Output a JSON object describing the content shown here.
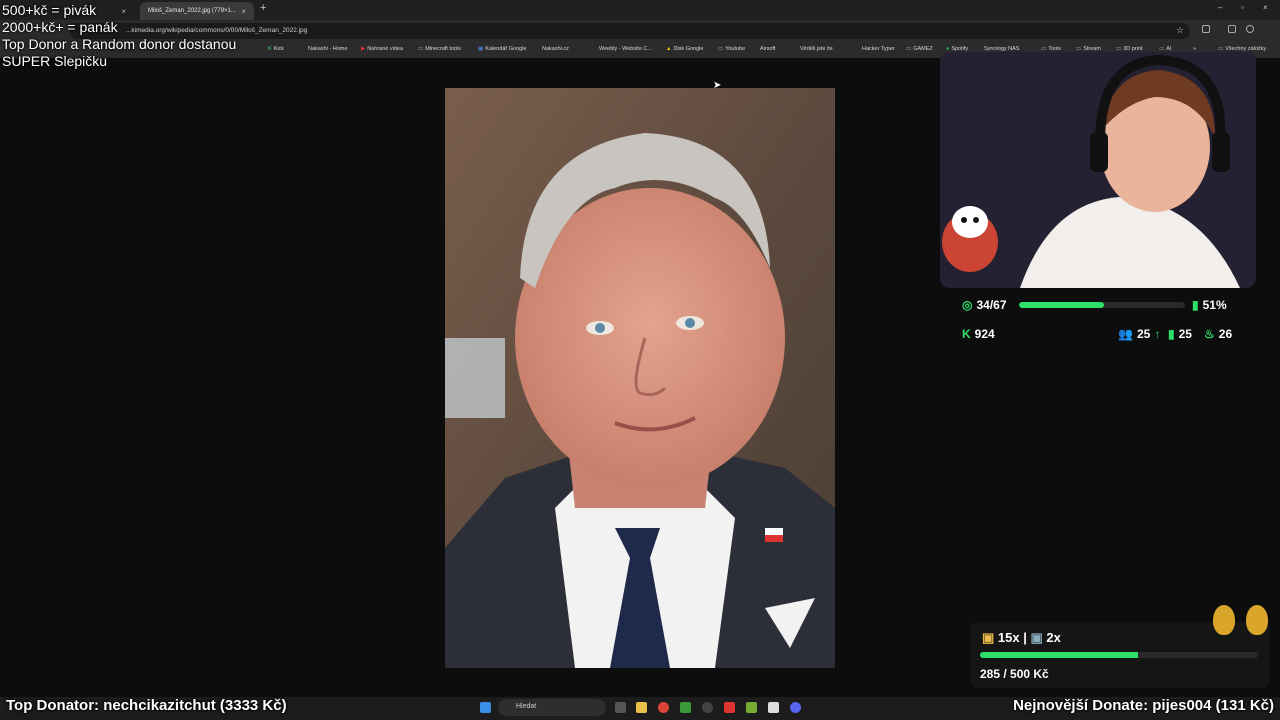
{
  "browser": {
    "tabs": [
      {
        "label": "..."
      },
      {
        "label": "Miloš_Zeman_2022.jpg (779×1..."
      }
    ],
    "url": "...kimedia.org/wikipedia/commons/0/00/Miloš_Zeman_2022.jpg",
    "bookmarks": [
      {
        "label": "Kick",
        "icon": "kick-icon"
      },
      {
        "label": "Nakashi - Home",
        "icon": "page-icon"
      },
      {
        "label": "Nahrané videa",
        "icon": "youtube-icon"
      },
      {
        "label": "Minecraft tools",
        "icon": "folder-icon"
      },
      {
        "label": "Kalendář Google",
        "icon": "calendar-icon"
      },
      {
        "label": "Nakashi.cz",
        "icon": "page-icon"
      },
      {
        "label": "Weebly - Website C...",
        "icon": "page-icon"
      },
      {
        "label": "Disk Google",
        "icon": "drive-icon"
      },
      {
        "label": "Youtube",
        "icon": "folder-icon"
      },
      {
        "label": "Airsoft",
        "icon": "page-icon"
      },
      {
        "label": "Věděli jste že",
        "icon": "page-icon"
      },
      {
        "label": "Hacker Typer",
        "icon": "page-icon"
      },
      {
        "label": "GAMEZ",
        "icon": "folder-icon"
      },
      {
        "label": "Spotify",
        "icon": "spotify-icon"
      },
      {
        "label": "Synology NAS",
        "icon": "page-icon"
      },
      {
        "label": "Tools",
        "icon": "folder-icon"
      },
      {
        "label": "Stream",
        "icon": "folder-icon"
      },
      {
        "label": "3D print",
        "icon": "folder-icon"
      },
      {
        "label": "AI",
        "icon": "folder-icon"
      },
      {
        "label": "Všechny záložky",
        "icon": "folder-icon"
      }
    ]
  },
  "overlay": {
    "rules": [
      "500+kč = pivák",
      "2000+kč+ = panák",
      "Top Donor a Random donor dostanou",
      "SUPER Slepičku"
    ]
  },
  "stats": {
    "goal": "34/67",
    "goal_progress": 0.51,
    "percent": "51%",
    "kick_count": "924",
    "followers": "25",
    "subs": "25",
    "fire": "26"
  },
  "donations": {
    "beer_count": "15x |",
    "shot_count": "2x",
    "progress_text": "285 / 500 Kč",
    "progress": 0.57,
    "top_donator": "Top Donator: nechcikazitchut (3333 Kč)",
    "newest_donate": "Nejnovější Donate: pijes004 (131 Kč)"
  },
  "taskbar": {
    "search_placeholder": "Hledat"
  },
  "colors": {
    "accent": "#2ee06a",
    "background": "#0d0d0d"
  }
}
